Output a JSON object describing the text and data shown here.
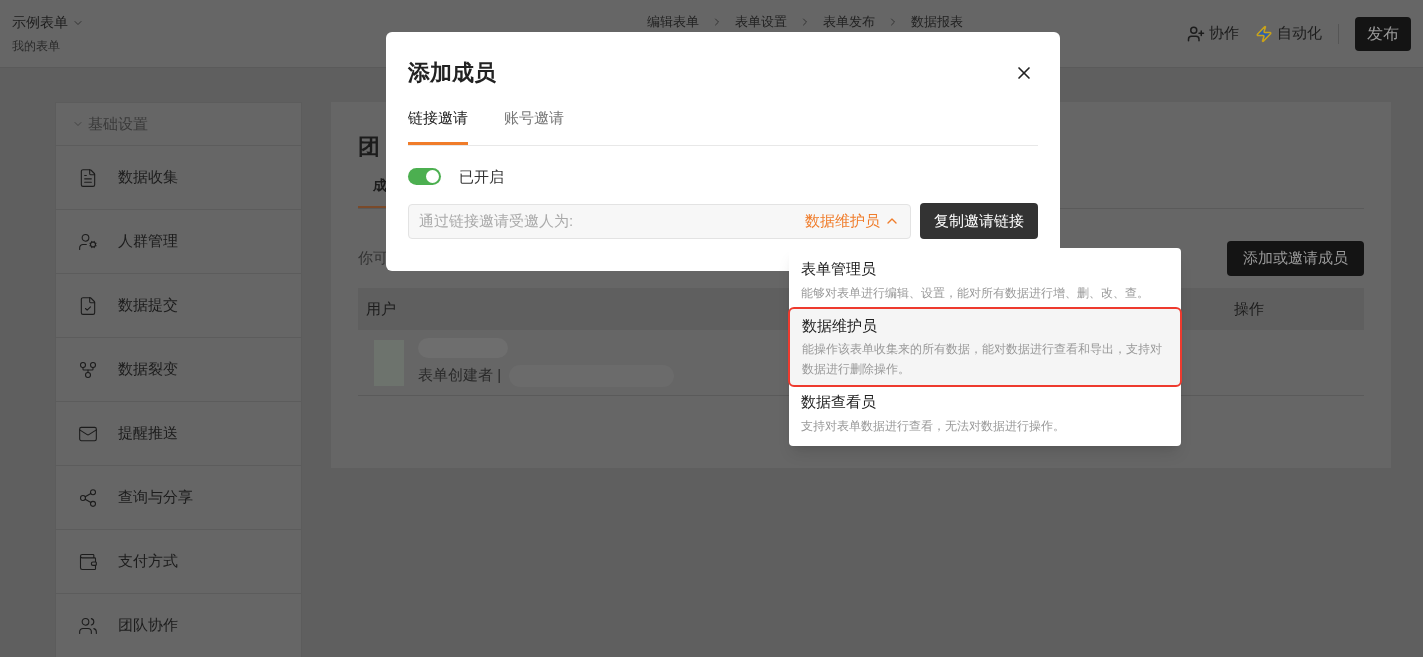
{
  "app": {
    "form_name": "示例表单",
    "breadcrumb": "我的表单"
  },
  "steps": [
    "编辑表单",
    "表单设置",
    "表单发布",
    "数据报表"
  ],
  "actions": [
    {
      "label": "协作",
      "kind": "collab"
    },
    {
      "label": "自动化",
      "kind": "automation"
    }
  ],
  "publish_button": "发布",
  "sidebar": {
    "section": "基础设置",
    "expanded": true,
    "items": [
      {
        "label": "数据收集"
      },
      {
        "label": "人群管理"
      },
      {
        "label": "数据提交"
      },
      {
        "label": "数据裂变"
      },
      {
        "label": "提醒推送"
      },
      {
        "label": "查询与分享"
      },
      {
        "label": "支付方式"
      },
      {
        "label": "团队协作"
      }
    ]
  },
  "main": {
    "title": "团",
    "tabs": [
      {
        "label": "成",
        "selected": true
      }
    ],
    "hint": "你可",
    "add_button": "添加或邀请成员",
    "columns": [
      "用户",
      "操作"
    ],
    "rows": [
      {
        "role": "表单创建者 |"
      }
    ]
  },
  "modal": {
    "title": "添加成员",
    "tabs": [
      {
        "label": "链接邀请",
        "selected": true
      },
      {
        "label": "账号邀请",
        "selected": false
      }
    ],
    "link_switch": {
      "on": true,
      "label": "已开启"
    },
    "invite_field": {
      "placeholder": "通过链接邀请受邀人为:",
      "role": "数据维护员",
      "expanded": true
    },
    "copy_button": "复制邀请链接",
    "role_menu": [
      {
        "title": "表单管理员",
        "description": "能够对表单进行编辑、设置，能对所有数据进行增、删、改、查。",
        "selected": false
      },
      {
        "title": "数据维护员",
        "description": "能操作该表单收集来的所有数据，能对数据进行查看和导出，支持对数据进行删除操作。",
        "selected": true
      },
      {
        "title": "数据查看员",
        "description": "支持对表单数据进行查看，无法对数据进行操作。",
        "selected": false
      }
    ]
  }
}
